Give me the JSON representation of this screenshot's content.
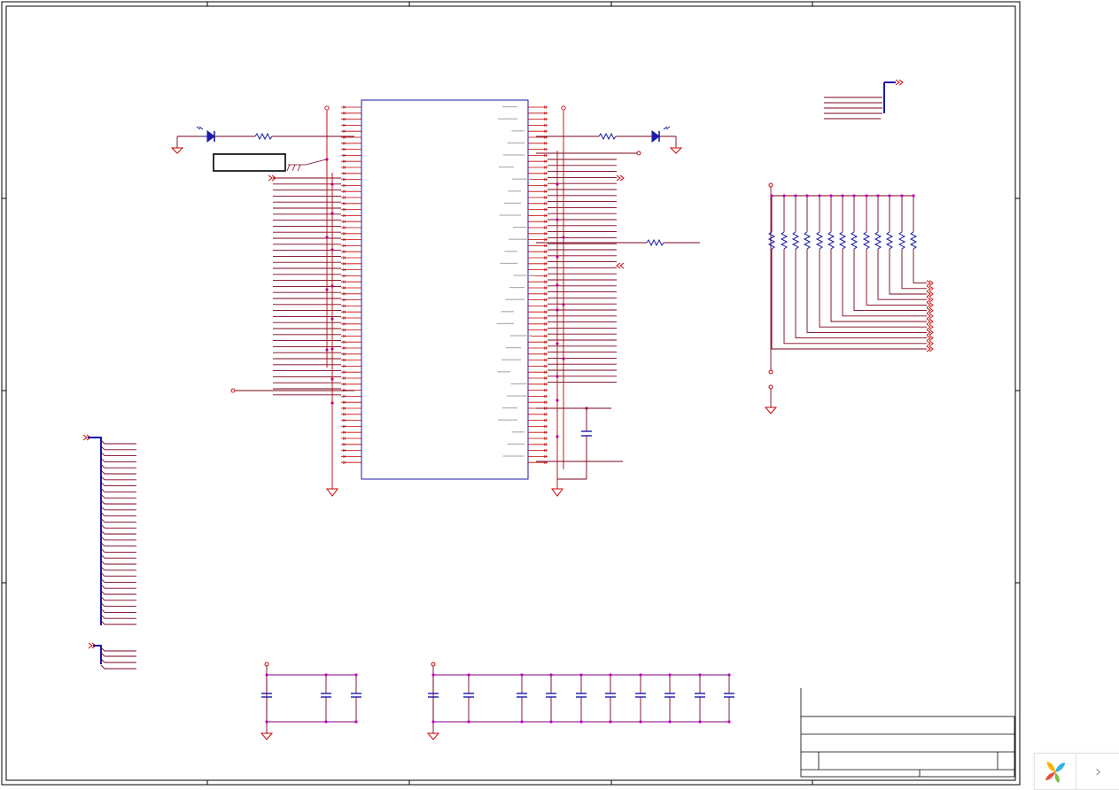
{
  "colors": {
    "frame": "#000000",
    "wire": "#7a0019",
    "pin": "#c00000",
    "junction": "#c000c0",
    "component": "#1a1aa8",
    "power": "#cc0000",
    "bus": "#1a1aa8",
    "power_rail": "#800080"
  },
  "icons": {
    "brand": "petal-logo-icon",
    "next": "chevron-right-icon"
  },
  "widget": {
    "next_glyph": "›"
  }
}
